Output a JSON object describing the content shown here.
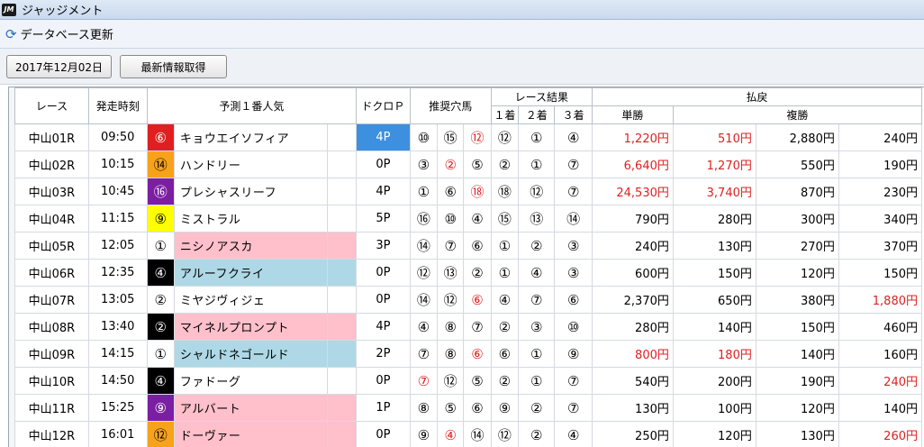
{
  "app": {
    "icon_text": "JM",
    "title": "ジャッジメント"
  },
  "menu": {
    "label": "データベース更新"
  },
  "toolbar": {
    "date_label": "2017年12月02日",
    "fetch_label": "最新情報取得"
  },
  "headers": {
    "race": "レース",
    "start": "発走時刻",
    "pred": "予測１番人気",
    "dokuro": "ドクロＰ",
    "osusume": "推奨穴馬",
    "result": "レース結果",
    "first": "１着",
    "second": "２着",
    "third": "３着",
    "payout": "払戻",
    "win": "単勝",
    "place": "複勝"
  },
  "colors": {
    "red": "#e02020",
    "orange": "#f7a21b",
    "purple": "#7b1fa2",
    "yellow": "#ffff00",
    "black": "#000000",
    "white": "#ffffff",
    "pink": "#ffc0cb",
    "lightblue": "#aed8e6",
    "dokuro_blue": "#3d8fe0"
  },
  "rows": [
    {
      "race": "中山01R",
      "time": "09:50",
      "num": "⑥",
      "num_bg": "red",
      "num_fg": "white",
      "name": "キョウエイソフィア",
      "name_bg": "",
      "dokuro": "4P",
      "dokuro_hi": true,
      "ana": [
        {
          "v": "⑩",
          "red": false
        },
        {
          "v": "⑮",
          "red": false
        },
        {
          "v": "⑫",
          "red": true
        }
      ],
      "res": [
        "⑫",
        "①",
        "④"
      ],
      "win": "1,220円",
      "win_red": true,
      "p1": "510円",
      "p1_red": true,
      "p2": "2,880円",
      "p2_red": false,
      "p3": "240円",
      "p3_red": false
    },
    {
      "race": "中山02R",
      "time": "10:15",
      "num": "⑭",
      "num_bg": "orange",
      "num_fg": "black",
      "name": "ハンドリー",
      "name_bg": "",
      "dokuro": "0P",
      "dokuro_hi": false,
      "ana": [
        {
          "v": "③",
          "red": false
        },
        {
          "v": "②",
          "red": true
        },
        {
          "v": "⑤",
          "red": false
        }
      ],
      "res": [
        "②",
        "①",
        "⑦"
      ],
      "win": "6,640円",
      "win_red": true,
      "p1": "1,270円",
      "p1_red": true,
      "p2": "550円",
      "p2_red": false,
      "p3": "190円",
      "p3_red": false
    },
    {
      "race": "中山03R",
      "time": "10:45",
      "num": "⑯",
      "num_bg": "purple",
      "num_fg": "white",
      "name": "プレシャスリーフ",
      "name_bg": "",
      "dokuro": "4P",
      "dokuro_hi": false,
      "ana": [
        {
          "v": "①",
          "red": false
        },
        {
          "v": "⑥",
          "red": false
        },
        {
          "v": "⑱",
          "red": true
        }
      ],
      "res": [
        "⑱",
        "⑫",
        "⑦"
      ],
      "win": "24,530円",
      "win_red": true,
      "p1": "3,740円",
      "p1_red": true,
      "p2": "870円",
      "p2_red": false,
      "p3": "230円",
      "p3_red": false
    },
    {
      "race": "中山04R",
      "time": "11:15",
      "num": "⑨",
      "num_bg": "yellow",
      "num_fg": "black",
      "name": "ミストラル",
      "name_bg": "",
      "dokuro": "5P",
      "dokuro_hi": false,
      "ana": [
        {
          "v": "⑯",
          "red": false
        },
        {
          "v": "⑩",
          "red": false
        },
        {
          "v": "④",
          "red": false
        }
      ],
      "res": [
        "⑮",
        "⑬",
        "⑭"
      ],
      "win": "790円",
      "win_red": false,
      "p1": "280円",
      "p1_red": false,
      "p2": "300円",
      "p2_red": false,
      "p3": "340円",
      "p3_red": false
    },
    {
      "race": "中山05R",
      "time": "12:05",
      "num": "①",
      "num_bg": "white",
      "num_fg": "black",
      "name": "ニシノアスカ",
      "name_bg": "pink",
      "dokuro": "3P",
      "dokuro_hi": false,
      "ana": [
        {
          "v": "⑭",
          "red": false
        },
        {
          "v": "⑦",
          "red": false
        },
        {
          "v": "⑥",
          "red": false
        }
      ],
      "res": [
        "①",
        "②",
        "③"
      ],
      "win": "240円",
      "win_red": false,
      "p1": "130円",
      "p1_red": false,
      "p2": "270円",
      "p2_red": false,
      "p3": "370円",
      "p3_red": false
    },
    {
      "race": "中山06R",
      "time": "12:35",
      "num": "④",
      "num_bg": "black",
      "num_fg": "white",
      "name": "アルーフクライ",
      "name_bg": "lightblue",
      "dokuro": "0P",
      "dokuro_hi": false,
      "ana": [
        {
          "v": "⑫",
          "red": false
        },
        {
          "v": "⑬",
          "red": false
        },
        {
          "v": "②",
          "red": false
        }
      ],
      "res": [
        "①",
        "④",
        "③"
      ],
      "win": "600円",
      "win_red": false,
      "p1": "150円",
      "p1_red": false,
      "p2": "120円",
      "p2_red": false,
      "p3": "150円",
      "p3_red": false
    },
    {
      "race": "中山07R",
      "time": "13:05",
      "num": "②",
      "num_bg": "white",
      "num_fg": "black",
      "name": "ミヤジヴィジェ",
      "name_bg": "",
      "dokuro": "0P",
      "dokuro_hi": false,
      "ana": [
        {
          "v": "⑭",
          "red": false
        },
        {
          "v": "⑫",
          "red": false
        },
        {
          "v": "⑥",
          "red": true
        }
      ],
      "res": [
        "④",
        "⑦",
        "⑥"
      ],
      "win": "2,370円",
      "win_red": false,
      "p1": "650円",
      "p1_red": false,
      "p2": "380円",
      "p2_red": false,
      "p3": "1,880円",
      "p3_red": true
    },
    {
      "race": "中山08R",
      "time": "13:40",
      "num": "②",
      "num_bg": "black",
      "num_fg": "white",
      "name": "マイネルプロンプト",
      "name_bg": "pink",
      "dokuro": "4P",
      "dokuro_hi": false,
      "ana": [
        {
          "v": "④",
          "red": false
        },
        {
          "v": "⑧",
          "red": false
        },
        {
          "v": "⑦",
          "red": false
        }
      ],
      "res": [
        "②",
        "③",
        "⑩"
      ],
      "win": "280円",
      "win_red": false,
      "p1": "140円",
      "p1_red": false,
      "p2": "150円",
      "p2_red": false,
      "p3": "460円",
      "p3_red": false
    },
    {
      "race": "中山09R",
      "time": "14:15",
      "num": "①",
      "num_bg": "white",
      "num_fg": "black",
      "name": "シャルドネゴールド",
      "name_bg": "lightblue",
      "dokuro": "2P",
      "dokuro_hi": false,
      "ana": [
        {
          "v": "⑦",
          "red": false
        },
        {
          "v": "⑧",
          "red": false
        },
        {
          "v": "⑥",
          "red": true
        }
      ],
      "res": [
        "⑥",
        "①",
        "⑨"
      ],
      "win": "800円",
      "win_red": true,
      "p1": "180円",
      "p1_red": true,
      "p2": "140円",
      "p2_red": false,
      "p3": "160円",
      "p3_red": false
    },
    {
      "race": "中山10R",
      "time": "14:50",
      "num": "④",
      "num_bg": "black",
      "num_fg": "white",
      "name": "ファドーグ",
      "name_bg": "",
      "dokuro": "0P",
      "dokuro_hi": false,
      "ana": [
        {
          "v": "⑦",
          "red": true
        },
        {
          "v": "⑫",
          "red": false
        },
        {
          "v": "⑤",
          "red": false
        }
      ],
      "res": [
        "②",
        "①",
        "⑦"
      ],
      "win": "540円",
      "win_red": false,
      "p1": "200円",
      "p1_red": false,
      "p2": "190円",
      "p2_red": false,
      "p3": "240円",
      "p3_red": true
    },
    {
      "race": "中山11R",
      "time": "15:25",
      "num": "⑨",
      "num_bg": "purple",
      "num_fg": "white",
      "name": "アルバート",
      "name_bg": "pink",
      "dokuro": "1P",
      "dokuro_hi": false,
      "ana": [
        {
          "v": "⑧",
          "red": false
        },
        {
          "v": "⑤",
          "red": false
        },
        {
          "v": "⑥",
          "red": false
        }
      ],
      "res": [
        "⑨",
        "②",
        "⑦"
      ],
      "win": "130円",
      "win_red": false,
      "p1": "100円",
      "p1_red": false,
      "p2": "120円",
      "p2_red": false,
      "p3": "140円",
      "p3_red": false
    },
    {
      "race": "中山12R",
      "time": "16:01",
      "num": "⑫",
      "num_bg": "orange",
      "num_fg": "black",
      "name": "ドーヴァー",
      "name_bg": "pink",
      "dokuro": "0P",
      "dokuro_hi": false,
      "ana": [
        {
          "v": "⑨",
          "red": false
        },
        {
          "v": "④",
          "red": true
        },
        {
          "v": "⑭",
          "red": false
        }
      ],
      "res": [
        "⑫",
        "②",
        "④"
      ],
      "win": "250円",
      "win_red": false,
      "p1": "120円",
      "p1_red": false,
      "p2": "130円",
      "p2_red": false,
      "p3": "260円",
      "p3_red": true
    }
  ]
}
